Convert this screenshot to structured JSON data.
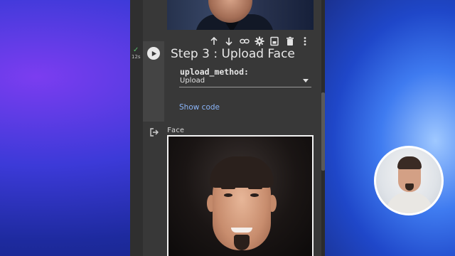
{
  "notebook": {
    "cell": {
      "title": "Step 3 : Upload Face",
      "exec_time": "12s",
      "param_label": "upload_method:",
      "param_value": "Upload",
      "show_code": "Show code",
      "output_label": "Face"
    },
    "toolbar": {
      "items": [
        "arrow-up-icon",
        "arrow-down-icon",
        "link-icon",
        "gear-icon",
        "mirror-icon",
        "trash-icon",
        "more-vert-icon"
      ]
    }
  },
  "colors": {
    "panel": "#383838",
    "link": "#8ab4f8",
    "success": "#5bbf6a"
  }
}
